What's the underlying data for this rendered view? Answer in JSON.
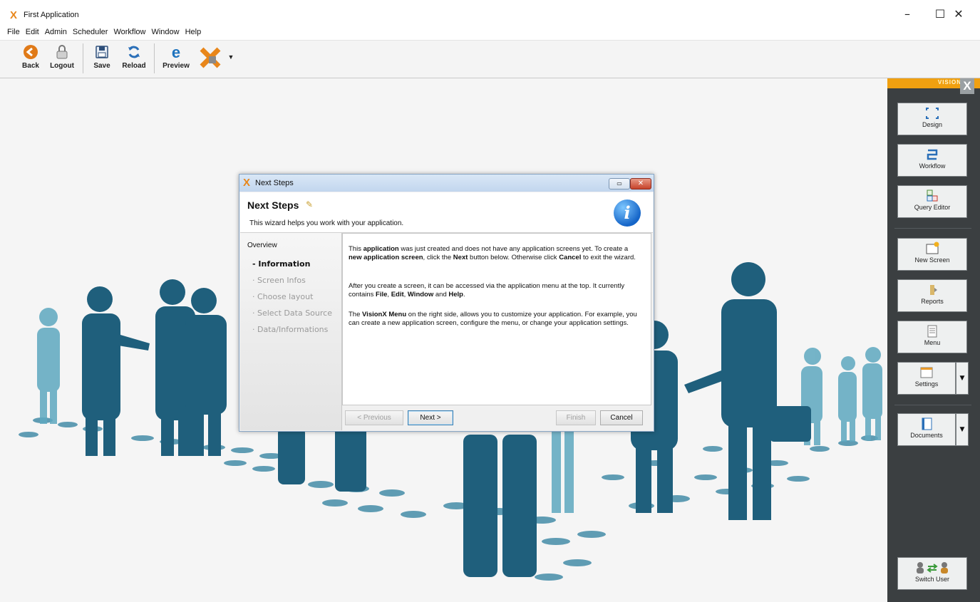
{
  "window": {
    "title": "First Application",
    "controls": {
      "minimize": "–",
      "maximize": "☐",
      "close": "✕"
    }
  },
  "menubar": {
    "items": [
      "File",
      "Edit",
      "Admin",
      "Scheduler",
      "Workflow",
      "Window",
      "Help"
    ]
  },
  "toolbar": {
    "back": "Back",
    "logout": "Logout",
    "save": "Save",
    "reload": "Reload",
    "preview": "Preview"
  },
  "right_panel": {
    "brand": "VISION",
    "brand_x": "X",
    "design": "Design",
    "workflow": "Workflow",
    "query_editor": "Query Editor",
    "new_screen": "New Screen",
    "reports": "Reports",
    "menu": "Menu",
    "settings": "Settings",
    "documents": "Documents",
    "switch_user": "Switch User"
  },
  "dialog": {
    "window_title": "Next Steps",
    "heading": "Next Steps",
    "subtitle": "This wizard helps you work with your application.",
    "overview_label": "Overview",
    "steps": [
      {
        "label": "Information",
        "active": true
      },
      {
        "label": "Screen Infos",
        "active": false
      },
      {
        "label": "Choose layout",
        "active": false
      },
      {
        "label": "Select Data Source",
        "active": false
      },
      {
        "label": "Data/Informations",
        "active": false
      }
    ],
    "paragraphs": {
      "p1": {
        "t1": "This ",
        "b1": "application",
        "t2": " was just created and does not have any application screens yet. To create a ",
        "b2": "new application screen",
        "t3": ", click the ",
        "b3": "Next",
        "t4": " button below. Otherwise click ",
        "b4": "Cancel",
        "t5": " to exit the wizard."
      },
      "p2": {
        "t1": "After you create a screen, it can be accessed via the application menu at the top. It currently contains ",
        "b1": "File",
        "t2": ", ",
        "b2": "Edit",
        "t3": ", ",
        "b3": "Window",
        "t4": " and ",
        "b4": "Help",
        "t5": "."
      },
      "p3": {
        "t1": "The ",
        "b1": "VisionX Menu",
        "t2": " on the right side, allows you to customize your application. For example, you can create a new application screen, configure the menu, or change your application settings."
      }
    },
    "buttons": {
      "previous": "< Previous",
      "next": "Next >",
      "finish": "Finish",
      "cancel": "Cancel"
    }
  },
  "colors": {
    "accent_orange": "#e8861a",
    "panel_dark": "#3b3f41",
    "silhouette_dark": "#1f5f7c",
    "silhouette_light": "#5ea8c0"
  }
}
